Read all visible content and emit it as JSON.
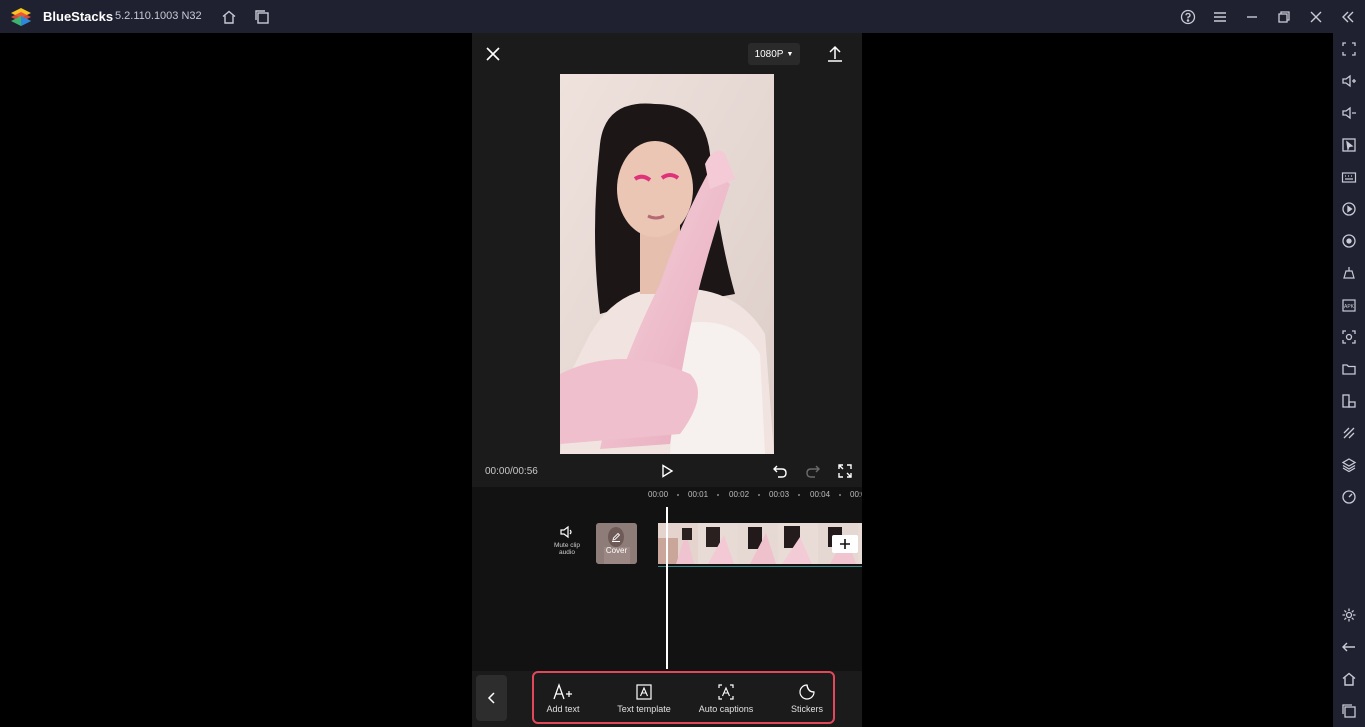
{
  "titlebar": {
    "app_name": "BlueStacks",
    "version": "5.2.110.1003",
    "build": "N32"
  },
  "editor": {
    "resolution": "1080P",
    "timecode": "00:00/00:56",
    "ruler": [
      "00:00",
      "00:01",
      "00:02",
      "00:03",
      "00:04",
      "00:0"
    ],
    "mute_label_1": "Mute clip",
    "mute_label_2": "audio",
    "cover_label": "Cover"
  },
  "tools": [
    {
      "label": "Add text",
      "icon": "add-text-icon"
    },
    {
      "label": "Text template",
      "icon": "text-template-icon"
    },
    {
      "label": "Auto captions",
      "icon": "auto-captions-icon"
    },
    {
      "label": "Stickers",
      "icon": "stickers-icon"
    }
  ],
  "colors": {
    "chrome": "#1f2130",
    "highlight": "#e3475a",
    "track_line": "#3a8a8a"
  }
}
